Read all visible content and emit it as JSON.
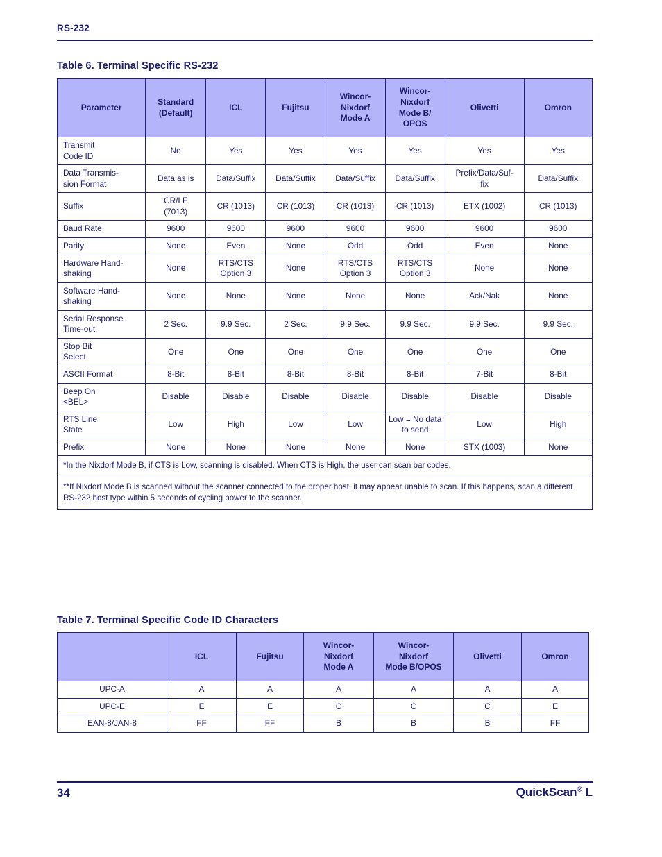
{
  "page": {
    "running_head": "RS-232",
    "folio": "34",
    "book_name": "QuickScan",
    "book_name_sup": "®",
    "book_name_suffix": " L"
  },
  "table6": {
    "caption": "Table 6. Terminal Specific RS-232",
    "headers": [
      "Parameter",
      "Standard\n(Default)",
      "ICL",
      "Fujitsu",
      "Wincor-\nNixdorf\nMode A",
      "Wincor-\nNixdorf\nMode B/\nOPOS",
      "Olivetti",
      "Omron"
    ],
    "rows": [
      [
        "Transmit\nCode ID",
        "No",
        "Yes",
        "Yes",
        "Yes",
        "Yes",
        "Yes",
        "Yes"
      ],
      [
        "Data Transmis-\nsion Format",
        "Data as is",
        "Data/Suffix",
        "Data/Suffix",
        "Data/Suffix",
        "Data/Suffix",
        "Prefix/Data/Suf-\nfix",
        "Data/Suffix"
      ],
      [
        "Suffix",
        "CR/LF\n(7013)",
        "CR (1013)",
        "CR (1013)",
        "CR (1013)",
        "CR (1013)",
        "ETX (1002)",
        "CR (1013)"
      ],
      [
        "Baud Rate",
        "9600",
        "9600",
        "9600",
        "9600",
        "9600",
        "9600",
        "9600"
      ],
      [
        "Parity",
        "None",
        "Even",
        "None",
        "Odd",
        "Odd",
        "Even",
        "None"
      ],
      [
        "Hardware Hand-\nshaking",
        "None",
        "RTS/CTS\nOption 3",
        "None",
        "RTS/CTS\nOption 3",
        "RTS/CTS\nOption 3",
        "None",
        "None"
      ],
      [
        "Software Hand-\nshaking",
        "None",
        "None",
        "None",
        "None",
        "None",
        "Ack/Nak",
        "None"
      ],
      [
        "Serial Response\nTime-out",
        "2 Sec.",
        "9.9 Sec.",
        "2 Sec.",
        "9.9 Sec.",
        "9.9 Sec.",
        "9.9 Sec.",
        "9.9 Sec."
      ],
      [
        "Stop Bit\nSelect",
        "One",
        "One",
        "One",
        "One",
        "One",
        "One",
        "One"
      ],
      [
        "ASCII Format",
        "8-Bit",
        "8-Bit",
        "8-Bit",
        "8-Bit",
        "8-Bit",
        "7-Bit",
        "8-Bit"
      ],
      [
        "Beep On\n<BEL>",
        "Disable",
        "Disable",
        "Disable",
        "Disable",
        "Disable",
        "Disable",
        "Disable"
      ],
      [
        "RTS Line\nState",
        "Low",
        "High",
        "Low",
        "Low",
        "Low = No data\nto send",
        "Low",
        "High"
      ],
      [
        "Prefix",
        "None",
        "None",
        "None",
        "None",
        "None",
        "STX (1003)",
        "None"
      ]
    ],
    "notes": [
      "*In the Nixdorf Mode B, if CTS is Low, scanning is disabled. When CTS is High, the user can scan bar codes.",
      "**If Nixdorf Mode B is scanned without the scanner connected to the proper host, it may appear unable to scan. If this happens, scan a different RS-232 host type within 5 seconds of cycling power to the scanner."
    ]
  },
  "table7": {
    "caption": "Table 7. Terminal Specific Code ID Characters",
    "headers": [
      "",
      "ICL",
      "Fujitsu",
      "Wincor-\nNixdorf\nMode A",
      "Wincor-\nNixdorf\nMode B/OPOS",
      "Olivetti",
      "Omron"
    ],
    "rows": [
      [
        "UPC-A",
        "A",
        "A",
        "A",
        "A",
        "A",
        "A"
      ],
      [
        "UPC-E",
        "E",
        "E",
        "C",
        "C",
        "C",
        "E"
      ],
      [
        "EAN-8/JAN-8",
        "FF",
        "FF",
        "B",
        "B",
        "B",
        "FF"
      ]
    ]
  },
  "colors": {
    "header_bg": "#b4b4fa",
    "text": "#1b1b6f",
    "border": "#20207a"
  }
}
